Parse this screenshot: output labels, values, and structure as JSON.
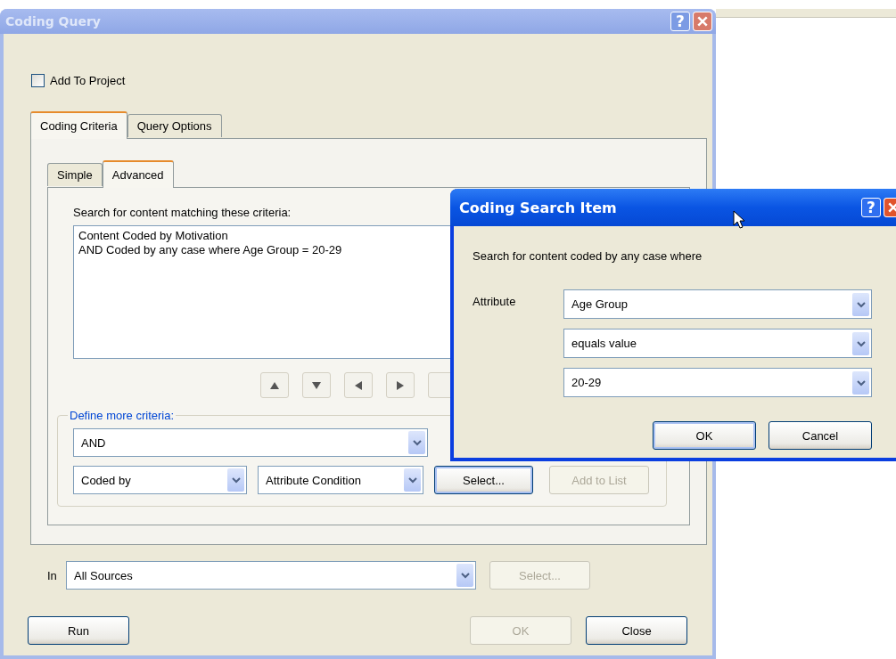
{
  "main_window": {
    "title": "Coding Query",
    "help_button": "?",
    "add_to_project": {
      "label": "Add To Project",
      "checked": false
    },
    "tabs": [
      {
        "label": "Coding Criteria",
        "selected": true
      },
      {
        "label": "Query Options",
        "selected": false
      }
    ],
    "subtabs": [
      {
        "label": "Simple",
        "selected": false
      },
      {
        "label": "Advanced",
        "selected": true
      }
    ],
    "criteria_label": "Search for content matching these criteria:",
    "criteria_lines": [
      "Content Coded by Motivation",
      "AND Coded by any case where Age Group = 20-29"
    ],
    "define_more": {
      "legend": "Define more criteria:",
      "operator": "AND",
      "coding": "Coded by",
      "condition": "Attribute Condition",
      "select_button": {
        "label": "Select...",
        "disabled": false
      },
      "add_button": {
        "label": "Add to List",
        "disabled": true
      }
    },
    "in": {
      "label": "In",
      "value": "All Sources",
      "select_button": {
        "label": "Select...",
        "disabled": true
      }
    },
    "buttons": [
      {
        "label": "Run",
        "disabled": false
      },
      {
        "label": "OK",
        "disabled": true
      },
      {
        "label": "Close",
        "disabled": false
      }
    ]
  },
  "search_dialog": {
    "title": "Coding Search Item",
    "help_button": "?",
    "prompt": "Search for content coded by any case where",
    "attribute_label": "Attribute",
    "fields": [
      "Age Group",
      "equals value",
      "20-29"
    ],
    "buttons": [
      {
        "label": "OK",
        "default": true
      },
      {
        "label": "Cancel",
        "default": false
      }
    ]
  }
}
